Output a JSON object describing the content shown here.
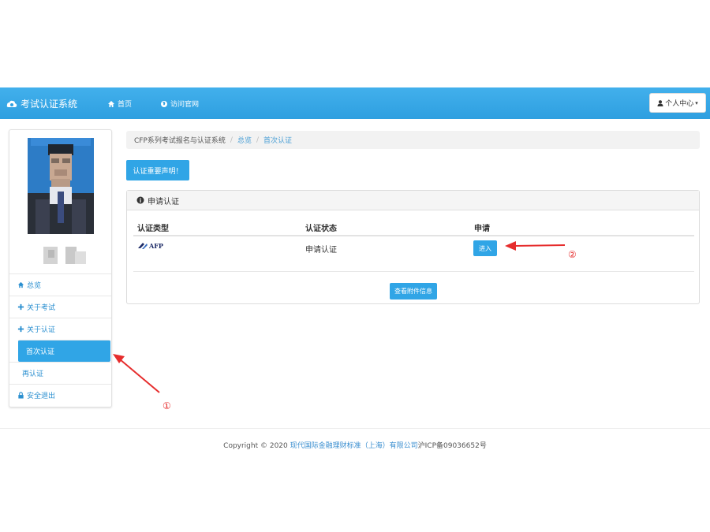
{
  "navbar": {
    "brand": "考试认证系统",
    "links": [
      {
        "label": "首页",
        "icon": "home-icon"
      },
      {
        "label": "访问官网",
        "icon": "globe-icon"
      }
    ],
    "user_menu": "个人中心",
    "background_color": "#35a6e8"
  },
  "sidebar": {
    "items": [
      {
        "label": "总览",
        "icon": "home-icon"
      },
      {
        "label": "关于考试",
        "icon": "plus-icon"
      },
      {
        "label": "关于认证",
        "icon": "plus-icon"
      },
      {
        "label": "首次认证",
        "active": true
      },
      {
        "label": "再认证"
      },
      {
        "label": "安全退出",
        "icon": "lock-icon"
      }
    ]
  },
  "breadcrumb": [
    "CFP系列考试报名与认证系统",
    "总览",
    "首次认证"
  ],
  "notice_button": "认证重要声明！",
  "panel": {
    "title": "申请认证",
    "columns": [
      "认证类型",
      "认证状态",
      "申请"
    ],
    "rows": [
      {
        "type_logo": "AFP",
        "status": "申请认证",
        "action": "进入"
      }
    ],
    "view_button": "查看附件信息"
  },
  "footer": {
    "prefix": "Copyright © 2020 ",
    "company": "现代国际金融理财标准（上海）有限公司",
    "icp": "沪ICP备09036652号"
  },
  "annotations": {
    "marker_1": "①",
    "marker_2": "②",
    "color": "#e62d2d"
  },
  "accent_color": "#30a5e6"
}
